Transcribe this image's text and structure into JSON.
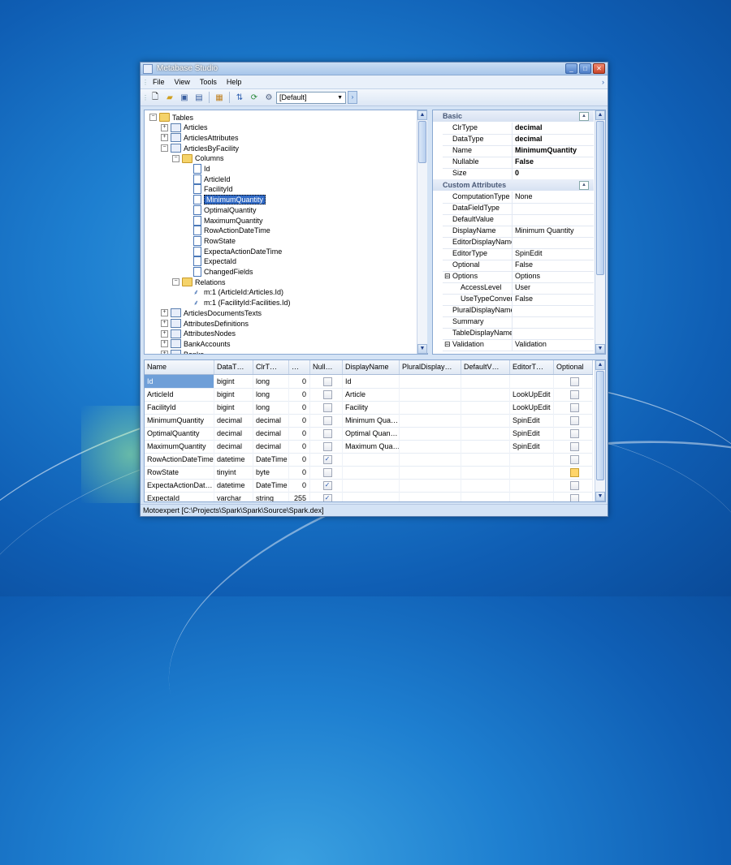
{
  "window": {
    "title": "Metabase Studio"
  },
  "menu": [
    "File",
    "View",
    "Tools",
    "Help"
  ],
  "toolbar": {
    "profile_combo": "[Default]"
  },
  "tree": [
    {
      "label": "Tables",
      "type": "folder",
      "exp": "−",
      "indent": 0
    },
    {
      "label": "Articles",
      "type": "table",
      "exp": "+",
      "indent": 1
    },
    {
      "label": "ArticlesAttributes",
      "type": "table",
      "exp": "+",
      "indent": 1
    },
    {
      "label": "ArticlesByFacility",
      "type": "table",
      "exp": "−",
      "indent": 1
    },
    {
      "label": "Columns",
      "type": "folder",
      "exp": "−",
      "indent": 2
    },
    {
      "label": "Id",
      "type": "col",
      "indent": 3
    },
    {
      "label": "ArticleId",
      "type": "col",
      "indent": 3
    },
    {
      "label": "FacilityId",
      "type": "col",
      "indent": 3
    },
    {
      "label": "MinimumQuantity",
      "type": "col",
      "indent": 3,
      "selected": true
    },
    {
      "label": "OptimalQuantity",
      "type": "col",
      "indent": 3
    },
    {
      "label": "MaximumQuantity",
      "type": "col",
      "indent": 3
    },
    {
      "label": "RowActionDateTime",
      "type": "col",
      "indent": 3
    },
    {
      "label": "RowState",
      "type": "col",
      "indent": 3
    },
    {
      "label": "ExpectaActionDateTime",
      "type": "col",
      "indent": 3
    },
    {
      "label": "ExpectaId",
      "type": "col",
      "indent": 3
    },
    {
      "label": "ChangedFields",
      "type": "col",
      "indent": 3
    },
    {
      "label": "Relations",
      "type": "folder",
      "exp": "−",
      "indent": 2
    },
    {
      "label": "m:1 (ArticleId:Articles.Id)",
      "type": "rel",
      "indent": 3
    },
    {
      "label": "m:1 (FacilityId:Facilities.Id)",
      "type": "rel",
      "indent": 3
    },
    {
      "label": "ArticlesDocumentsTexts",
      "type": "table",
      "exp": "+",
      "indent": 1
    },
    {
      "label": "AttributesDefinitions",
      "type": "table",
      "exp": "+",
      "indent": 1
    },
    {
      "label": "AttributesNodes",
      "type": "table",
      "exp": "+",
      "indent": 1
    },
    {
      "label": "BankAccounts",
      "type": "table",
      "exp": "+",
      "indent": 1
    },
    {
      "label": "Banks",
      "type": "table",
      "exp": "+",
      "indent": 1
    }
  ],
  "properties": {
    "basic_title": "Basic",
    "basic": [
      {
        "name": "ClrType",
        "value": "decimal",
        "bold": true
      },
      {
        "name": "DataType",
        "value": "decimal",
        "bold": true
      },
      {
        "name": "Name",
        "value": "MinimumQuantity",
        "bold": true
      },
      {
        "name": "Nullable",
        "value": "False",
        "bold": true
      },
      {
        "name": "Size",
        "value": "0",
        "bold": true
      }
    ],
    "custom_title": "Custom Attributes",
    "custom": [
      {
        "name": "ComputationType",
        "value": "None"
      },
      {
        "name": "DataFieldType",
        "value": ""
      },
      {
        "name": "DefaultValue",
        "value": ""
      },
      {
        "name": "DisplayName",
        "value": "Minimum Quantity"
      },
      {
        "name": "EditorDisplayName",
        "value": ""
      },
      {
        "name": "EditorType",
        "value": "SpinEdit"
      },
      {
        "name": "Optional",
        "value": "False"
      },
      {
        "name": "Options",
        "value": "Options",
        "exp": "−"
      },
      {
        "name": "AccessLevel",
        "value": "User",
        "sub": true
      },
      {
        "name": "UseTypeConverter",
        "value": "False",
        "sub": true
      },
      {
        "name": "PluralDisplayName",
        "value": ""
      },
      {
        "name": "Summary",
        "value": ""
      },
      {
        "name": "TableDisplayName",
        "value": ""
      },
      {
        "name": "Validation",
        "value": "Validation",
        "exp": "−"
      }
    ]
  },
  "grid": {
    "headers": [
      "Name",
      "DataT…",
      "ClrT…",
      "…",
      "Null…",
      "DisplayName",
      "PluralDisplay…",
      "DefaultV…",
      "EditorT…",
      "Optional"
    ],
    "rows": [
      {
        "name": "Id",
        "datatype": "bigint",
        "clrtype": "long",
        "size": "0",
        "nullable": false,
        "display": "Id",
        "plural": "",
        "default": "",
        "editor": "",
        "optional": false
      },
      {
        "name": "ArticleId",
        "datatype": "bigint",
        "clrtype": "long",
        "size": "0",
        "nullable": false,
        "display": "Article",
        "plural": "",
        "default": "",
        "editor": "LookUpEdit",
        "optional": false
      },
      {
        "name": "FacilityId",
        "datatype": "bigint",
        "clrtype": "long",
        "size": "0",
        "nullable": false,
        "display": "Facility",
        "plural": "",
        "default": "",
        "editor": "LookUpEdit",
        "optional": false
      },
      {
        "name": "MinimumQuantity",
        "datatype": "decimal",
        "clrtype": "decimal",
        "size": "0",
        "nullable": false,
        "display": "Minimum Qua…",
        "plural": "",
        "default": "",
        "editor": "SpinEdit",
        "optional": false
      },
      {
        "name": "OptimalQuantity",
        "datatype": "decimal",
        "clrtype": "decimal",
        "size": "0",
        "nullable": false,
        "display": "Optimal Quan…",
        "plural": "",
        "default": "",
        "editor": "SpinEdit",
        "optional": false
      },
      {
        "name": "MaximumQuantity",
        "datatype": "decimal",
        "clrtype": "decimal",
        "size": "0",
        "nullable": false,
        "display": "Maximum Qua…",
        "plural": "",
        "default": "",
        "editor": "SpinEdit",
        "optional": false
      },
      {
        "name": "RowActionDateTime",
        "datatype": "datetime",
        "clrtype": "DateTime",
        "size": "0",
        "nullable": true,
        "display": "",
        "plural": "",
        "default": "",
        "editor": "",
        "optional": false
      },
      {
        "name": "RowState",
        "datatype": "tinyint",
        "clrtype": "byte",
        "size": "0",
        "nullable": false,
        "display": "",
        "plural": "",
        "default": "",
        "editor": "",
        "optional": true
      },
      {
        "name": "ExpectaActionDat…",
        "datatype": "datetime",
        "clrtype": "DateTime",
        "size": "0",
        "nullable": true,
        "display": "",
        "plural": "",
        "default": "",
        "editor": "",
        "optional": false
      },
      {
        "name": "ExpectaId",
        "datatype": "varchar",
        "clrtype": "string",
        "size": "255",
        "nullable": true,
        "display": "",
        "plural": "",
        "default": "",
        "editor": "",
        "optional": false
      }
    ]
  },
  "status": "Motoexpert [C:\\Projects\\Spark\\Spark\\Source\\Spark.dex]"
}
